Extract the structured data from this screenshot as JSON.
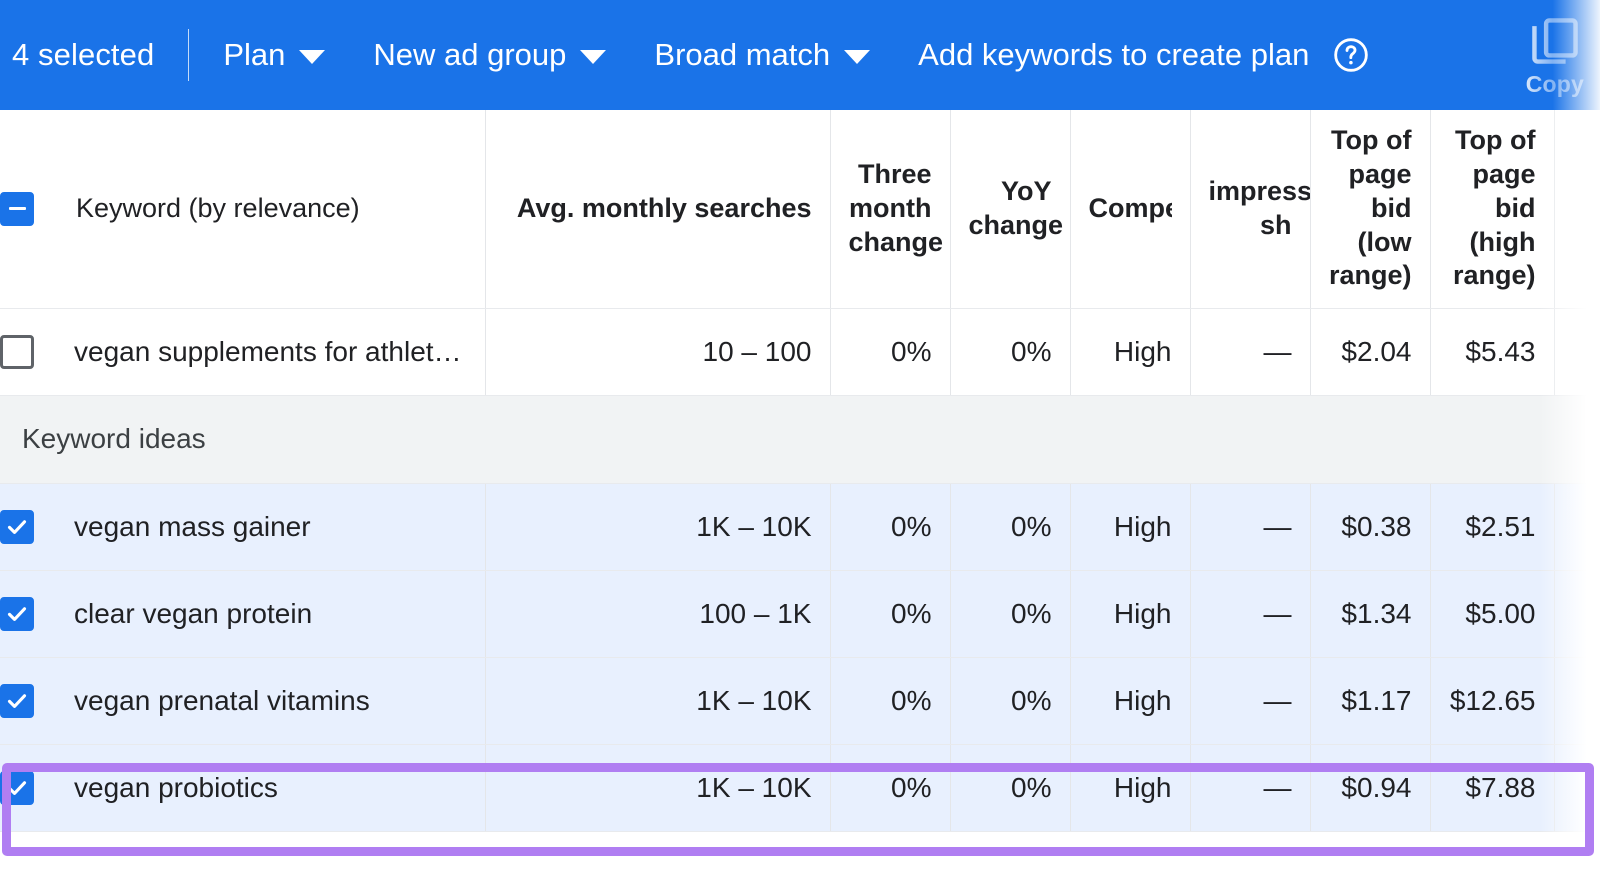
{
  "toolbar": {
    "selected_count_label": "4 selected",
    "plan_menu": "Plan",
    "ad_group_menu": "New ad group",
    "match_type_menu": "Broad match",
    "add_keywords_action": "Add keywords to create plan",
    "help_icon_name": "help-icon",
    "copy_label": "Copy",
    "accent_color": "#1a73e8"
  },
  "table": {
    "columns": [
      {
        "key": "keyword",
        "label": "Keyword (by relevance)",
        "align": "left"
      },
      {
        "key": "avg",
        "label": "Avg. monthly searches",
        "align": "right"
      },
      {
        "key": "three",
        "label": "Three month change",
        "align": "right"
      },
      {
        "key": "yoy",
        "label": "YoY change",
        "align": "right"
      },
      {
        "key": "comp",
        "label": "Compet",
        "align": "right"
      },
      {
        "key": "share",
        "label": "impresss sh",
        "align": "right"
      },
      {
        "key": "bid_low",
        "label": "Top of page bid (low range)",
        "align": "right"
      },
      {
        "key": "bid_high",
        "label": "Top of page bid (high range)",
        "align": "right"
      }
    ],
    "header_checkbox_state": "indeterminate",
    "section_label": "Keyword ideas",
    "rows_top": [
      {
        "checked": false,
        "keyword": "vegan supplements for athlet…",
        "avg": "10 – 100",
        "three": "0%",
        "yoy": "0%",
        "comp": "High",
        "share": "—",
        "bid_low": "$2.04",
        "bid_high": "$5.43"
      }
    ],
    "rows_ideas": [
      {
        "checked": true,
        "keyword": "vegan mass gainer",
        "avg": "1K – 10K",
        "three": "0%",
        "yoy": "0%",
        "comp": "High",
        "share": "—",
        "bid_low": "$0.38",
        "bid_high": "$2.51"
      },
      {
        "checked": true,
        "keyword": "clear vegan protein",
        "avg": "100 – 1K",
        "three": "0%",
        "yoy": "0%",
        "comp": "High",
        "share": "—",
        "bid_low": "$1.34",
        "bid_high": "$5.00"
      },
      {
        "checked": true,
        "keyword": "vegan prenatal vitamins",
        "avg": "1K – 10K",
        "three": "0%",
        "yoy": "0%",
        "comp": "High",
        "share": "—",
        "bid_low": "$1.17",
        "bid_high": "$12.65"
      },
      {
        "checked": true,
        "keyword": "vegan probiotics",
        "avg": "1K – 10K",
        "three": "0%",
        "yoy": "0%",
        "comp": "High",
        "share": "—",
        "bid_low": "$0.94",
        "bid_high": "$7.88"
      }
    ]
  },
  "annotation": {
    "highlight_color": "#b07ef2",
    "highlight_target_keyword": "vegan probiotics"
  }
}
